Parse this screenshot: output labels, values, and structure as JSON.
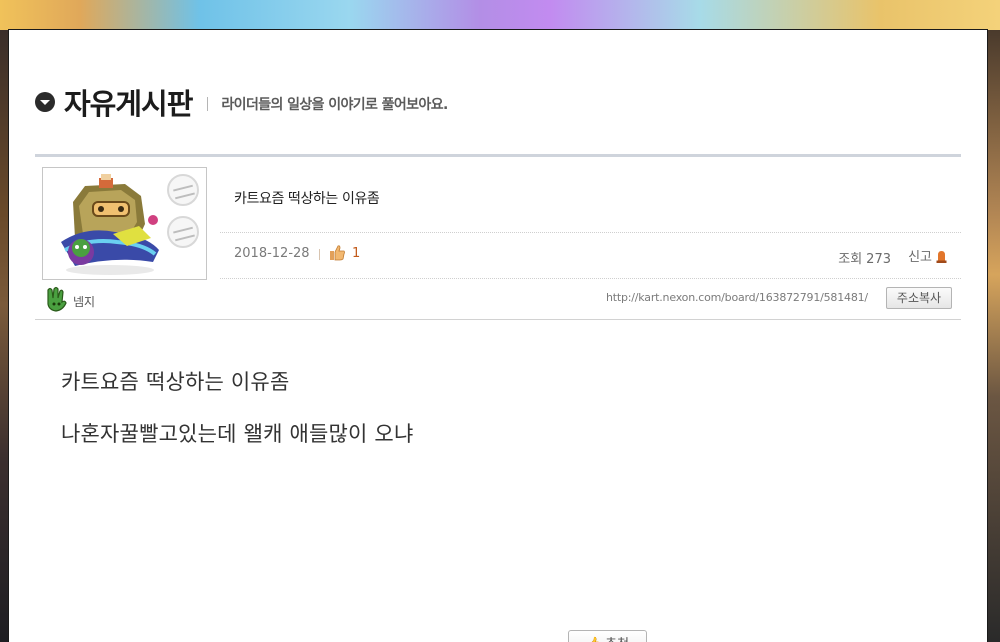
{
  "board": {
    "title": "자유게시판",
    "description": "라이더들의 일상을 이야기로 풀어보아요."
  },
  "post": {
    "title": "카트요즘 떡상하는 이유좀",
    "date": "2018-12-28",
    "likes": "1",
    "views_label": "조회",
    "views": "273",
    "report_label": "신고",
    "author": "넴지",
    "url": "http://kart.nexon.com/board/163872791/581481/",
    "copy_button": "주소복사",
    "body": [
      "카트요즘 떡상하는 이유좀",
      "나혼자꿀빨고있는데 왤캐 애들많이 오냐"
    ],
    "bottom_button": "추천"
  },
  "colors": {
    "accent_like": "#c25a1a",
    "report_icon": "#e2762b",
    "author_icon": "#3f8a2c"
  }
}
